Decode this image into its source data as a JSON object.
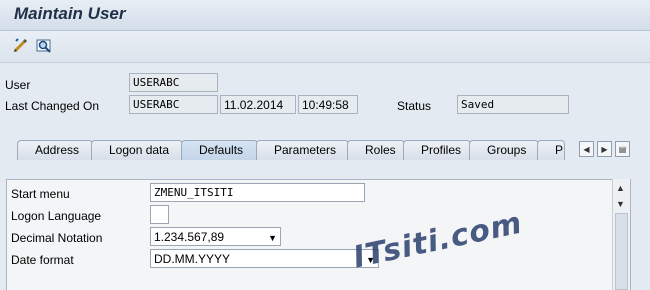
{
  "window": {
    "title": "Maintain User"
  },
  "toolbar": {
    "icons": [
      "change-icon",
      "display-icon"
    ]
  },
  "header_fields": {
    "user_label": "User",
    "user_value": "USERABC",
    "last_changed_label": "Last Changed On",
    "last_changed_by": "USERABC",
    "last_changed_date": "11.02.2014",
    "last_changed_time": "10:49:58",
    "status_label": "Status",
    "status_value": "Saved"
  },
  "tabs": [
    {
      "label": "Address"
    },
    {
      "label": "Logon data"
    },
    {
      "label": "Defaults",
      "active": true
    },
    {
      "label": "Parameters"
    },
    {
      "label": "Roles"
    },
    {
      "label": "Profiles"
    },
    {
      "label": "Groups"
    },
    {
      "label": "P"
    }
  ],
  "defaults": {
    "start_menu_label": "Start menu",
    "start_menu_value": "ZMENU_ITSITI",
    "logon_language_label": "Logon Language",
    "logon_language_value": "",
    "decimal_notation_label": "Decimal Notation",
    "decimal_notation_value": "1.234.567,89",
    "date_format_label": "Date format",
    "date_format_value": "DD.MM.YYYY"
  },
  "watermark": "ITsiti.com"
}
